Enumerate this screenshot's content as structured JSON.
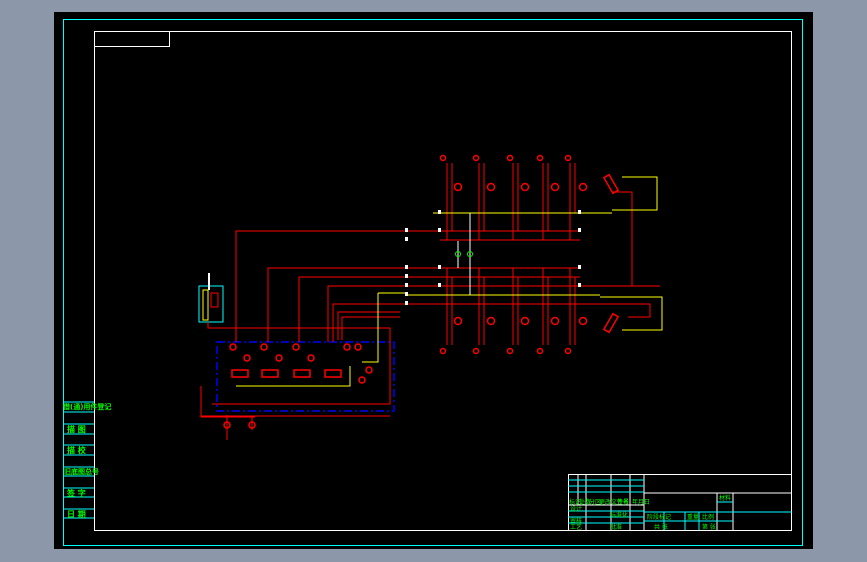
{
  "colors": {
    "background": "#8d97aa",
    "canvas": "#000000",
    "frame": "#ffffff",
    "outer_frame": "#00ffff",
    "hydraulic_lines": "#ff0000",
    "pilot_lines": "#ffff00",
    "boundary": "#0000ff",
    "text": "#00ff00"
  },
  "side_labels": [
    "借(通)用件登记",
    "描 图",
    "描 校",
    "旧底图总号",
    "签 字",
    "日 期"
  ],
  "title_block": {
    "revision_header": [
      "标记",
      "处数",
      "分区",
      "更改文件号",
      "签名",
      "年月日"
    ],
    "rows": [
      "设计",
      "审核",
      "工艺"
    ],
    "approval": [
      "标准化",
      "批准"
    ],
    "stage_header": [
      "阶段标记",
      "重量",
      "比例"
    ],
    "sheets": [
      "共 张",
      "第 张"
    ],
    "material": "材料"
  }
}
